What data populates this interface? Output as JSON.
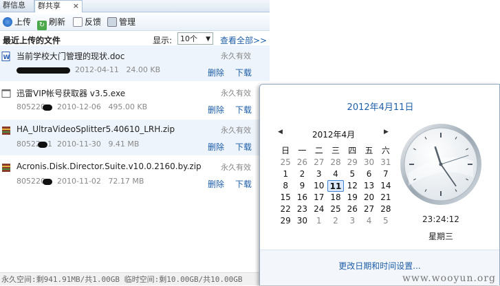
{
  "tabs": [
    {
      "label": "群信息"
    },
    {
      "label": "群共享"
    }
  ],
  "tab_close": "×",
  "toolbar": {
    "upload": "上传",
    "refresh": "刷新",
    "feedback": "反馈",
    "manage": "管理"
  },
  "list_header": {
    "title": "最近上传的文件",
    "display_label": "显示:",
    "display_value": "10个",
    "view_all": "查看全部>>"
  },
  "files": [
    {
      "name": "当前学校大门管理的现状.doc",
      "status": "永久有效",
      "uploader_prefix": "",
      "date": "2012-04-11",
      "size": "24.00 KB",
      "delete": "删除",
      "download": "下载"
    },
    {
      "name": "迅雷VIP帐号获取器 v3.5.exe",
      "status": "永久有效",
      "uploader_prefix": "805220",
      "date": "2010-12-06",
      "size": "495.00 KB",
      "delete": "删除",
      "download": "下载"
    },
    {
      "name": "HA_UltraVideoSplitter5.40610_LRH.zip",
      "status": "永久有效",
      "uploader_prefix": "80522",
      "uploader_suffix": "1",
      "date": "2010-11-30",
      "size": "9.41 MB",
      "delete": "删除",
      "download": "下载"
    },
    {
      "name": "Acronis.Disk.Director.Suite.v10.0.2160.by.zip",
      "status": "永久有效",
      "uploader_prefix": "805220",
      "date": "2010-11-02",
      "size": "72.17 MB",
      "delete": "删除",
      "download": "下载"
    }
  ],
  "status_bar": "永久空间:剩941.91MB/共1.00GB 临时空间:剩10.00GB/共10.00GB",
  "calendar": {
    "full_date": "2012年4月11日",
    "month_label": "2012年4月",
    "prev": "◀",
    "next": "▶",
    "weekdays": [
      "日",
      "一",
      "二",
      "三",
      "四",
      "五",
      "六"
    ],
    "weeks": [
      [
        "25",
        "26",
        "27",
        "28",
        "29",
        "30",
        "31"
      ],
      [
        "1",
        "2",
        "3",
        "4",
        "5",
        "6",
        "7"
      ],
      [
        "8",
        "9",
        "10",
        "11",
        "12",
        "13",
        "14"
      ],
      [
        "15",
        "16",
        "17",
        "18",
        "19",
        "20",
        "21"
      ],
      [
        "22",
        "23",
        "24",
        "25",
        "26",
        "27",
        "28"
      ],
      [
        "29",
        "30",
        "1",
        "2",
        "3",
        "4",
        "5"
      ]
    ],
    "today": "11",
    "time": "23:24:12",
    "weekday": "星期三",
    "settings_link": "更改日期和时间设置..."
  },
  "watermark": "www.wooyun.org",
  "colors": {
    "link": "#1d5ea8",
    "doc_icon": "#2b5fb4",
    "zip_icon": "#8a3b2b"
  },
  "icons": {
    "upload": "upload-icon",
    "refresh": "refresh-icon",
    "feedback": "feedback-icon",
    "manage": "manage-icon"
  }
}
